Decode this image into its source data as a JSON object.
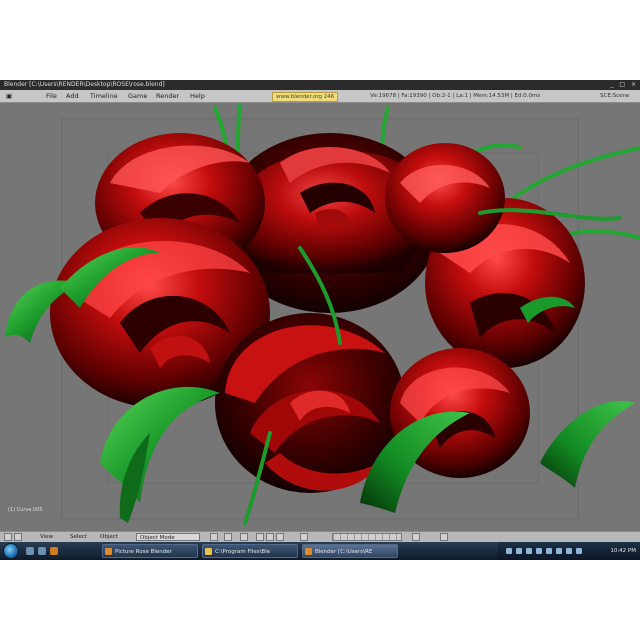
{
  "window": {
    "title": "Blender [C:\\Users\\RENDER\\Desktop\\ROSE\\rose.blend]",
    "controls": "_ □ ×"
  },
  "menubar": {
    "items": [
      "File",
      "Add",
      "Timeline",
      "Game",
      "Render",
      "Help"
    ],
    "link": "www.blender.org 246",
    "stats": "Ve:19678 | Fa:19390 | Ob:2-1 | La:1 | Mem:14.53M | Ed:0.0ms",
    "scene": "SCE:Scene"
  },
  "viewport": {
    "frame_label": "(1) Curve.005",
    "background": "#767676"
  },
  "view_header": {
    "items": [
      "View",
      "Select",
      "Object"
    ],
    "mode": "Object Mode"
  },
  "taskbar": {
    "tasks": [
      "Picture Rose Blender",
      "C:\\Program Files\\Ble",
      "Blender [C:\\Users\\RE"
    ],
    "clock": "10:42 PM"
  },
  "colors": {
    "petal": "#b40a0a",
    "petal_dark": "#3a0000",
    "leaf": "#1e9e2e",
    "taskbar": "#1b2b40"
  },
  "icons": [
    "windows-start-icon",
    "blender-app-icon",
    "folder-icon",
    "network-tray-icon",
    "volume-tray-icon"
  ]
}
